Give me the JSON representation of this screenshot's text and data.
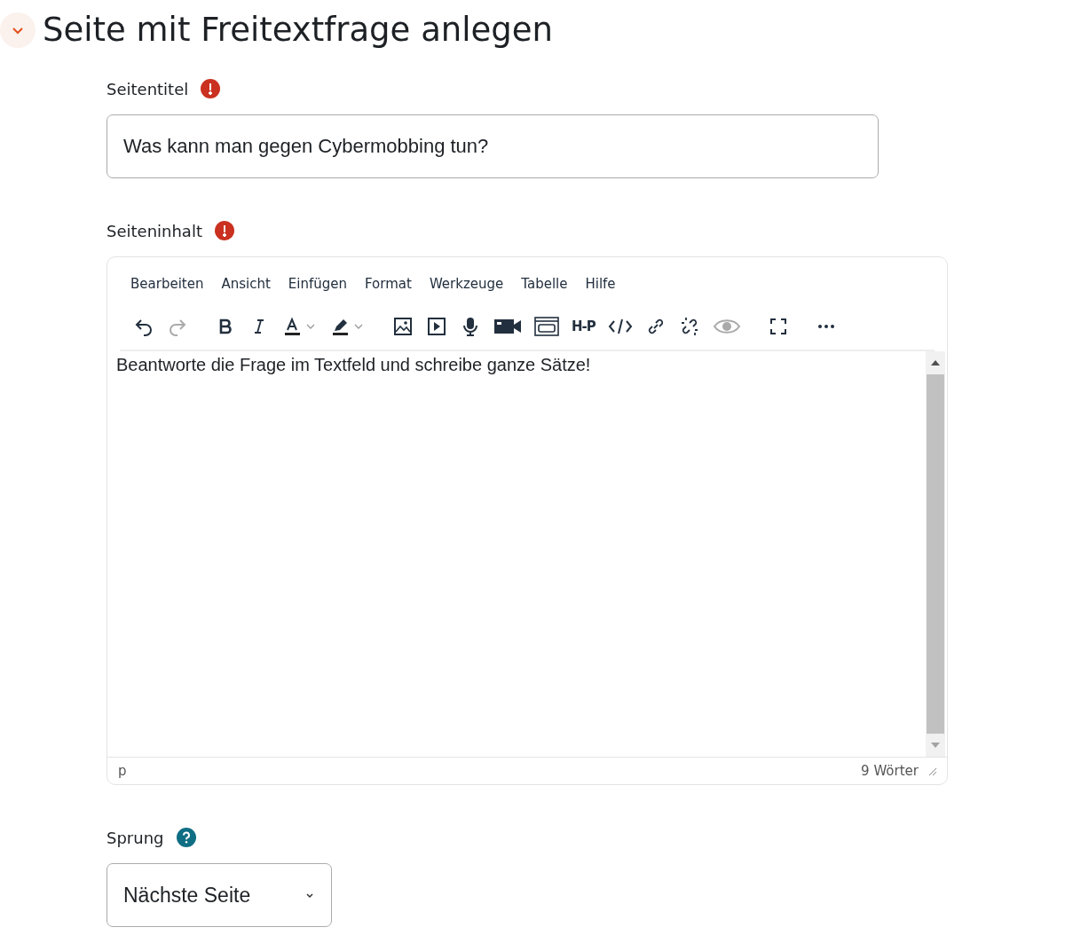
{
  "section": {
    "title": "Seite mit Freitextfrage anlegen",
    "expanded": true
  },
  "title_field": {
    "label": "Seitentitel",
    "required": true,
    "value": "Was kann man gegen Cybermobbing tun?"
  },
  "content_field": {
    "label": "Seiteninhalt",
    "required": true
  },
  "editor": {
    "menu": [
      "Bearbeiten",
      "Ansicht",
      "Einfügen",
      "Format",
      "Werkzeuge",
      "Tabelle",
      "Hilfe"
    ],
    "toolbar": [
      {
        "kind": "undo",
        "disabled": false
      },
      {
        "kind": "redo",
        "disabled": true
      },
      {
        "kind": "gap"
      },
      {
        "kind": "bold",
        "disabled": false
      },
      {
        "kind": "italic",
        "disabled": false
      },
      {
        "kind": "textcolor",
        "disabled": false
      },
      {
        "kind": "highlight",
        "disabled": false
      },
      {
        "kind": "gap"
      },
      {
        "kind": "image",
        "disabled": false
      },
      {
        "kind": "media",
        "disabled": false
      },
      {
        "kind": "mic",
        "disabled": false
      },
      {
        "kind": "camera",
        "disabled": false
      },
      {
        "kind": "embed",
        "disabled": false
      },
      {
        "kind": "text",
        "glyph": "H-P",
        "disabled": false
      },
      {
        "kind": "html",
        "disabled": false
      },
      {
        "kind": "link",
        "disabled": false
      },
      {
        "kind": "unlink",
        "disabled": false
      },
      {
        "kind": "eye",
        "disabled": true
      },
      {
        "kind": "gap"
      },
      {
        "kind": "fullscreen",
        "disabled": false
      },
      {
        "kind": "gap"
      },
      {
        "kind": "more",
        "disabled": false
      }
    ],
    "content": "Beantworte die Frage im Textfeld und schreibe ganze Sätze!",
    "path": "p",
    "word_count": "9 Wörter"
  },
  "jump_field": {
    "label": "Sprung",
    "help": true,
    "value": "Nächste Seite"
  }
}
